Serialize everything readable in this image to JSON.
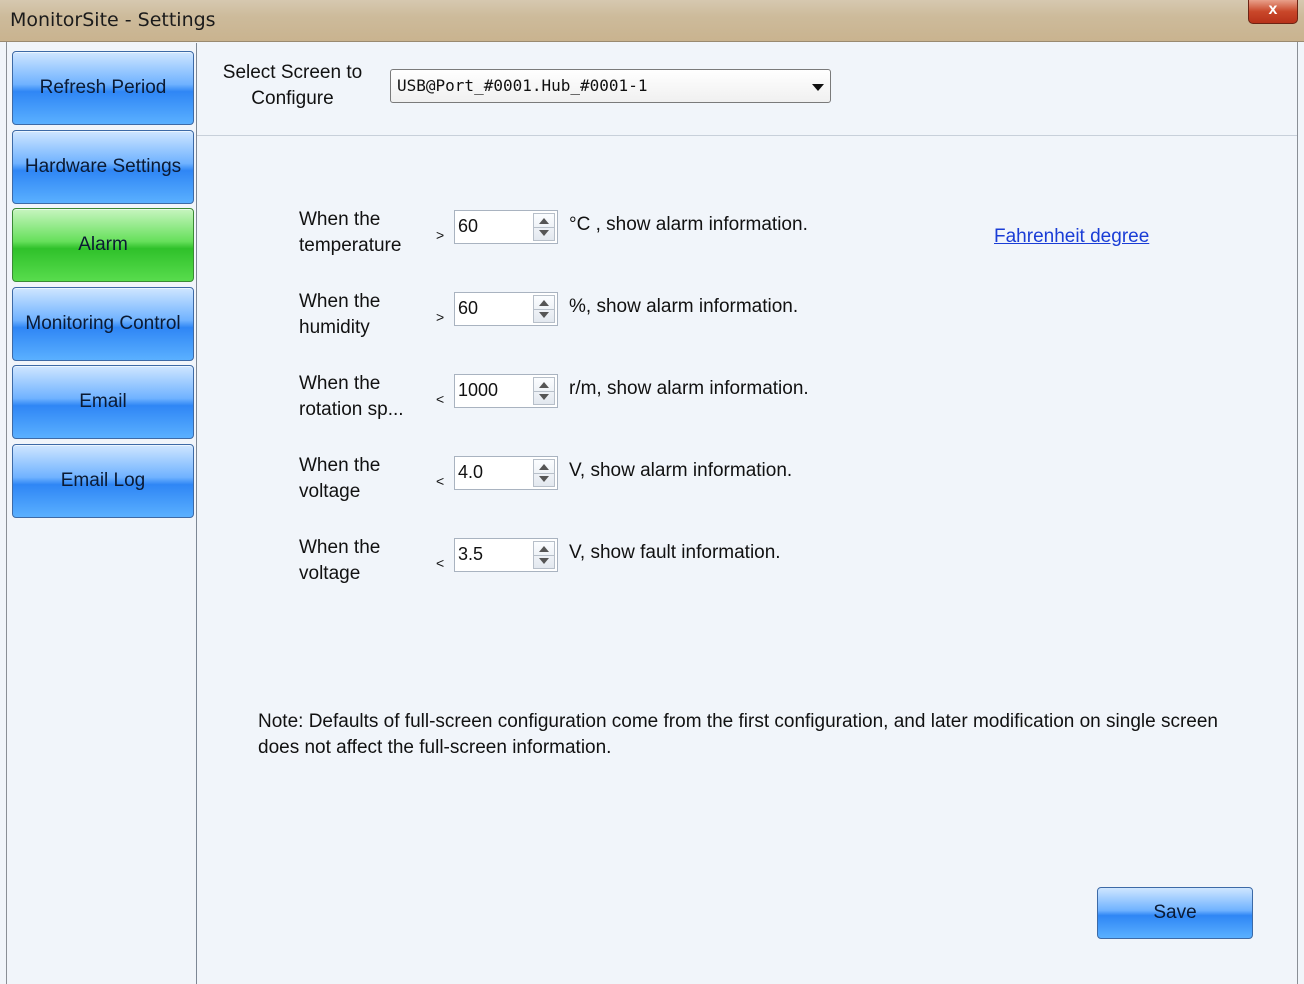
{
  "window": {
    "title": "MonitorSite - Settings",
    "close_label": "x"
  },
  "sidebar": {
    "items": [
      {
        "label": "Refresh Period",
        "active": false
      },
      {
        "label": "Hardware Settings",
        "active": false
      },
      {
        "label": "Alarm",
        "active": true
      },
      {
        "label": "Monitoring Control",
        "active": false
      },
      {
        "label": "Email",
        "active": false
      },
      {
        "label": "Email Log",
        "active": false
      }
    ]
  },
  "header": {
    "select_label": "Select Screen to Configure",
    "selected_screen": "USB@Port_#0001.Hub_#0001-1"
  },
  "alarm": {
    "rows": [
      {
        "label": "When the temperature",
        "operator": ">",
        "value": "60",
        "unit_text": "°C  , show alarm information."
      },
      {
        "label": "When the humidity",
        "operator": ">",
        "value": "60",
        "unit_text": "%, show alarm information."
      },
      {
        "label": "When the rotation sp...",
        "operator": "<",
        "value": "1000",
        "unit_text": "r/m, show alarm information."
      },
      {
        "label": "When the voltage",
        "operator": "<",
        "value": "4.0",
        "unit_text": "V, show alarm information."
      },
      {
        "label": "When the voltage",
        "operator": "<",
        "value": "3.5",
        "unit_text": "V, show fault information."
      }
    ],
    "fahrenheit_link": "Fahrenheit degree",
    "note": "Note: Defaults of full-screen configuration come from the first configuration, and later modification on single screen does not affect the full-screen information.",
    "save_label": "Save"
  },
  "colors": {
    "nav_blue": "#2f86f5",
    "nav_green": "#2fc12a",
    "link": "#1a3dd6",
    "background": "#f1f5fa"
  }
}
